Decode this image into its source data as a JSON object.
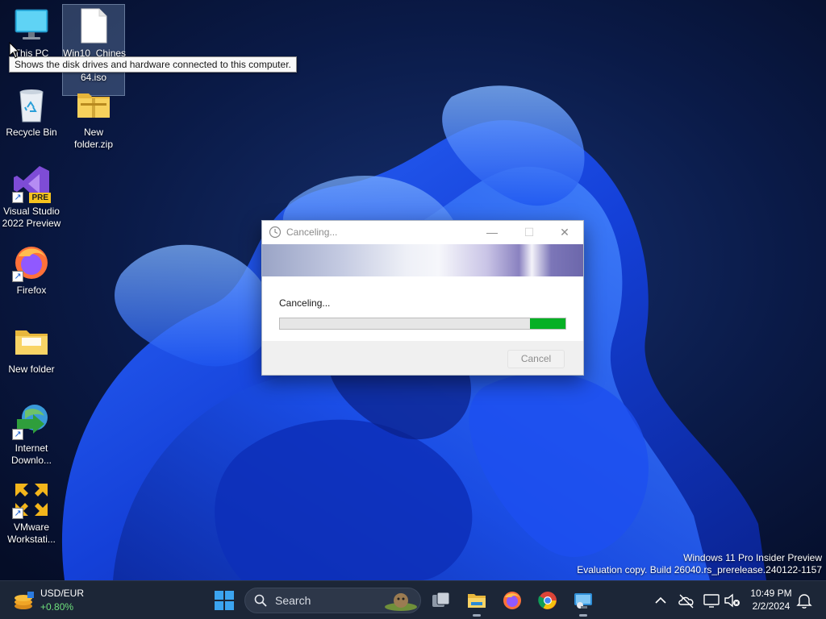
{
  "desktop": {
    "icons": [
      {
        "id": "this-pc",
        "label": "This PC"
      },
      {
        "id": "iso",
        "label": "Win10_Chines\nHongKong)_x\n64.iso"
      },
      {
        "id": "recycle-bin",
        "label": "Recycle Bin"
      },
      {
        "id": "new-folder-zip",
        "label": "New\nfolder.zip"
      },
      {
        "id": "visual-studio",
        "label": "Visual Studio\n2022 Preview",
        "badge": "PRE"
      },
      {
        "id": "firefox",
        "label": "Firefox"
      },
      {
        "id": "new-folder",
        "label": "New folder"
      },
      {
        "id": "idm",
        "label": "Internet\nDownlo..."
      },
      {
        "id": "vmware",
        "label": "VMware\nWorkstati..."
      }
    ],
    "tooltip": "Shows the disk drives and hardware connected to this computer."
  },
  "dialog": {
    "title": "Canceling...",
    "status": "Canceling...",
    "progress": {
      "track_fraction_start": 0.875,
      "track_fraction_end": 1.0,
      "color": "#06b025"
    },
    "cancel_label": "Cancel",
    "buttons": {
      "minimize": "—",
      "maximize": "☐",
      "close": "✕"
    }
  },
  "watermark": {
    "line1": "Windows 11 Pro Insider Preview",
    "line2": "Evaluation copy. Build 26040.rs_prerelease.240122-1157"
  },
  "taskbar": {
    "widget": {
      "line1": "USD/EUR",
      "line2": "+0.80%",
      "line2_color": "#6ee07c"
    },
    "search_placeholder": "Search",
    "apps": [
      "start-icon",
      "search",
      "task-view-icon",
      "file-explorer-icon",
      "firefox-icon",
      "chrome-icon",
      "remote-desktop-icon"
    ],
    "tray": [
      "show-hidden-icons-chevron",
      "onedrive-icon",
      "network-icon",
      "volume-muted-icon",
      "notification-bell-icon"
    ],
    "time": "10:49 PM",
    "date": "2/2/2024"
  }
}
